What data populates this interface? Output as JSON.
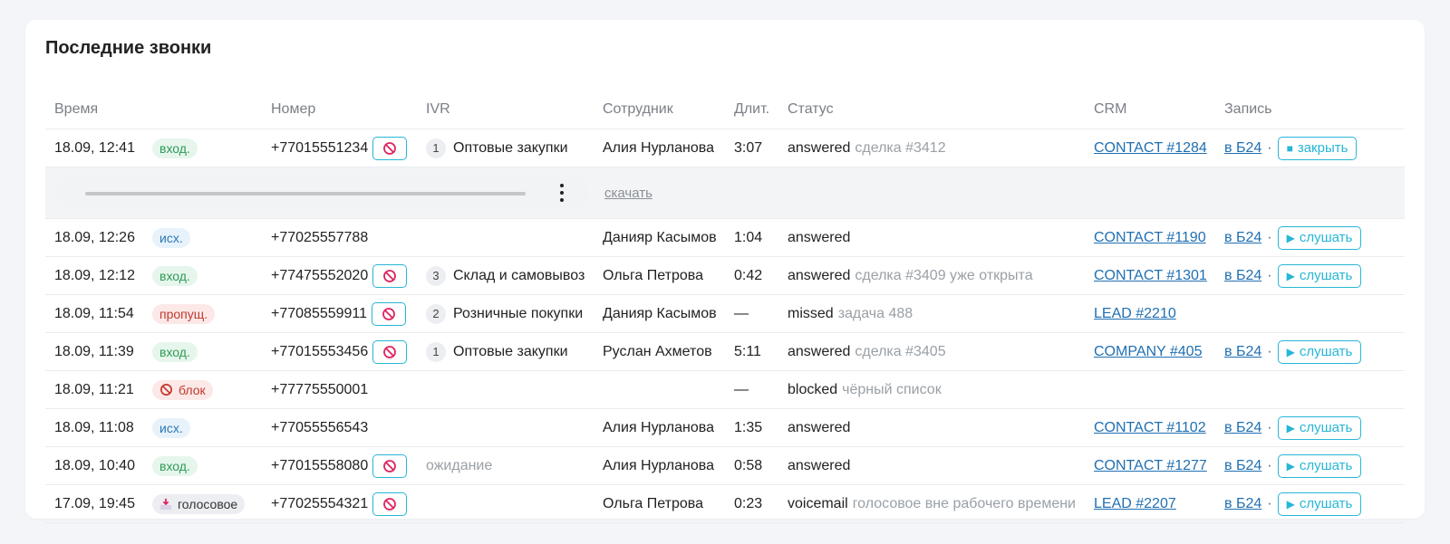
{
  "title": "Последние звонки",
  "columns": {
    "time": "Время",
    "number": "Номер",
    "ivr": "IVR",
    "employee": "Сотрудник",
    "duration": "Длит.",
    "status": "Статус",
    "crm": "CRM",
    "record": "Запись"
  },
  "player": {
    "download_label": "скачать"
  },
  "rows": [
    {
      "time": "18.09, 12:41",
      "type": "вход.",
      "type_kind": "in",
      "number": "+77015551234",
      "block_btn": true,
      "ivr_num": "1",
      "ivr_text": "Оптовые закупки",
      "employee": "Алия Нурланова",
      "duration": "3:07",
      "status": "answered",
      "status_note": "сделка #3412",
      "crm": "CONTACT #1284",
      "b24": "в Б24",
      "sep": "·",
      "action": "закрыть",
      "action_glyph": "■",
      "player_open": true
    },
    {
      "time": "18.09, 12:26",
      "type": "исх.",
      "type_kind": "out",
      "number": "+77025557788",
      "block_btn": false,
      "ivr_num": "",
      "ivr_text": "",
      "employee": "Данияр Касымов",
      "duration": "1:04",
      "status": "answered",
      "status_note": "",
      "crm": "CONTACT #1190",
      "b24": "в Б24",
      "sep": "·",
      "action": "слушать",
      "action_glyph": "▶"
    },
    {
      "time": "18.09, 12:12",
      "type": "вход.",
      "type_kind": "in",
      "number": "+77475552020",
      "block_btn": true,
      "ivr_num": "3",
      "ivr_text": "Склад и самовывоз",
      "employee": "Ольга Петрова",
      "duration": "0:42",
      "status": "answered",
      "status_note": "сделка #3409 уже открыта",
      "crm": "CONTACT #1301",
      "b24": "в Б24",
      "sep": "·",
      "action": "слушать",
      "action_glyph": "▶"
    },
    {
      "time": "18.09, 11:54",
      "type": "пропущ.",
      "type_kind": "miss",
      "number": "+77085559911",
      "block_btn": true,
      "ivr_num": "2",
      "ivr_text": "Розничные покупки",
      "employee": "Данияр Касымов",
      "duration": "—",
      "status": "missed",
      "status_note": "задача 488",
      "crm": "LEAD #2210",
      "b24": "",
      "sep": "",
      "action": "",
      "action_glyph": ""
    },
    {
      "time": "18.09, 11:39",
      "type": "вход.",
      "type_kind": "in",
      "number": "+77015553456",
      "block_btn": true,
      "ivr_num": "1",
      "ivr_text": "Оптовые закупки",
      "employee": "Руслан Ахметов",
      "duration": "5:11",
      "status": "answered",
      "status_note": "сделка #3405",
      "crm": "COMPANY #405",
      "b24": "в Б24",
      "sep": "·",
      "action": "слушать",
      "action_glyph": "▶"
    },
    {
      "time": "18.09, 11:21",
      "type": "блок",
      "type_kind": "blk",
      "type_icon": "blocked-icon",
      "number": "+77775550001",
      "block_btn": false,
      "ivr_num": "",
      "ivr_text": "",
      "employee": "",
      "duration": "—",
      "status": "blocked",
      "status_note": "чёрный список",
      "crm": "",
      "b24": "",
      "sep": "",
      "action": "",
      "action_glyph": ""
    },
    {
      "time": "18.09, 11:08",
      "type": "исх.",
      "type_kind": "out",
      "number": "+77055556543",
      "block_btn": false,
      "ivr_num": "",
      "ivr_text": "",
      "employee": "Алия Нурланова",
      "duration": "1:35",
      "status": "answered",
      "status_note": "",
      "crm": "CONTACT #1102",
      "b24": "в Б24",
      "sep": "·",
      "action": "слушать",
      "action_glyph": "▶"
    },
    {
      "time": "18.09, 10:40",
      "type": "вход.",
      "type_kind": "in",
      "number": "+77015558080",
      "block_btn": true,
      "ivr_num": "",
      "ivr_text": "ожидание",
      "ivr_muted": true,
      "employee": "Алия Нурланова",
      "duration": "0:58",
      "status": "answered",
      "status_note": "",
      "crm": "CONTACT #1277",
      "b24": "в Б24",
      "sep": "·",
      "action": "слушать",
      "action_glyph": "▶"
    },
    {
      "time": "17.09, 19:45",
      "type": "голосовое",
      "type_kind": "vm",
      "type_icon": "voicemail-inbox-icon",
      "number": "+77025554321",
      "block_btn": true,
      "ivr_num": "",
      "ivr_text": "",
      "employee": "Ольга Петрова",
      "duration": "0:23",
      "status": "voicemail",
      "status_note": "голосовое вне рабочего времени",
      "crm": "LEAD #2207",
      "b24": "в Б24",
      "sep": "·",
      "action": "слушать",
      "action_glyph": "▶"
    }
  ],
  "colors": {
    "accent": "#27b6d6",
    "link": "#1f6fb2",
    "in_bg": "#e6f6ec",
    "out_bg": "#e7f2fb",
    "miss_bg": "#fde8e8",
    "block_icon": "#e0245e"
  }
}
